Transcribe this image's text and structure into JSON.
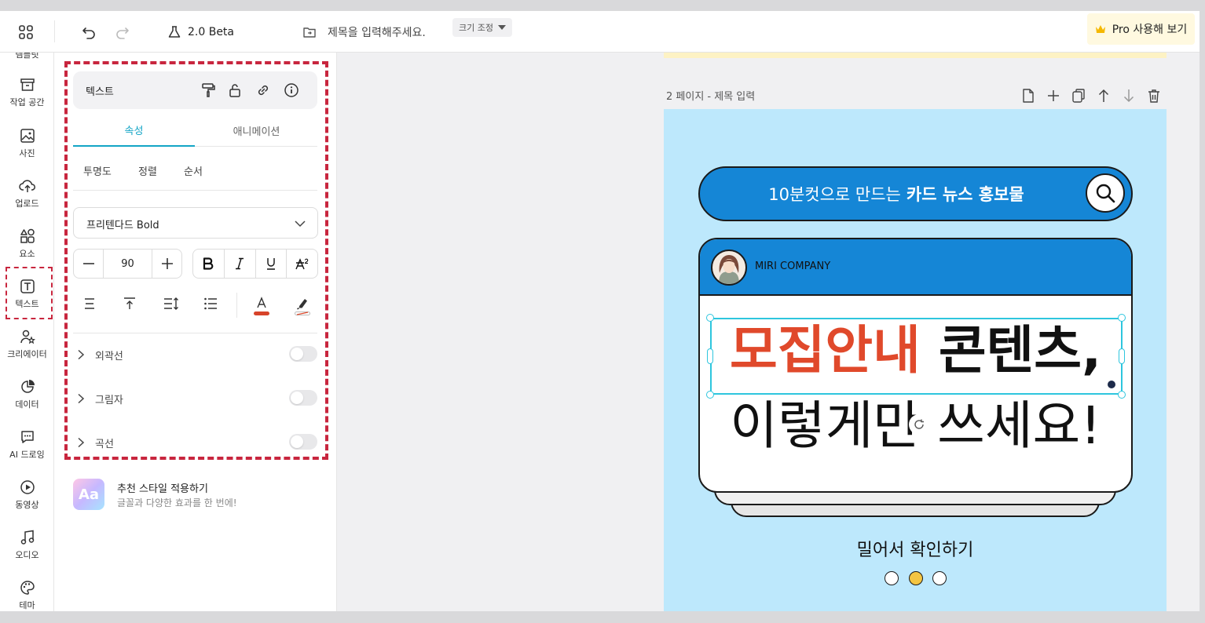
{
  "topbar": {
    "version": "2.0 Beta",
    "title_placeholder": "제목을 입력해주세요.",
    "resize_label": "크기 조정",
    "pro_label": "Pro 사용해 보기"
  },
  "rail": {
    "items": [
      {
        "label": "템플릿"
      },
      {
        "label": "작업 공간"
      },
      {
        "label": "사진"
      },
      {
        "label": "업로드"
      },
      {
        "label": "요소"
      },
      {
        "label": "텍스트"
      },
      {
        "label": "크리에이터"
      },
      {
        "label": "데이터"
      },
      {
        "label": "AI 드로잉"
      },
      {
        "label": "동영상"
      },
      {
        "label": "오디오"
      },
      {
        "label": "테마"
      }
    ]
  },
  "panel": {
    "title": "텍스트",
    "tabs": [
      "속성",
      "애니메이션"
    ],
    "subtabs": [
      "투명도",
      "정렬",
      "순서"
    ],
    "font": "프리텐다드 Bold",
    "font_size": "90",
    "toggles": [
      "외곽선",
      "그림자",
      "곡선"
    ],
    "recommend_title": "추천 스타일 적용하기",
    "recommend_sub": "글꼴과 다양한 효과를 한 번에!",
    "recommend_icon_text": "Aa",
    "text_color": "#d7442a"
  },
  "canvas": {
    "page_label": "2 페이지 - 제목 입력",
    "search_text_normal": "10분컷으로 만드는",
    "search_text_bold": "카드 뉴스 홍보물",
    "company": "MIRI COMPANY",
    "headline_red": "모집안내",
    "headline_black": "콘텐츠,",
    "headline_line2": "이렇게만 쓰세요!",
    "swipe_text": "밀어서 확인하기",
    "dots": [
      false,
      true,
      false
    ],
    "accent_red": "#e0492b",
    "card_blue": "#1586d6",
    "page_bg": "#bde8fc"
  }
}
